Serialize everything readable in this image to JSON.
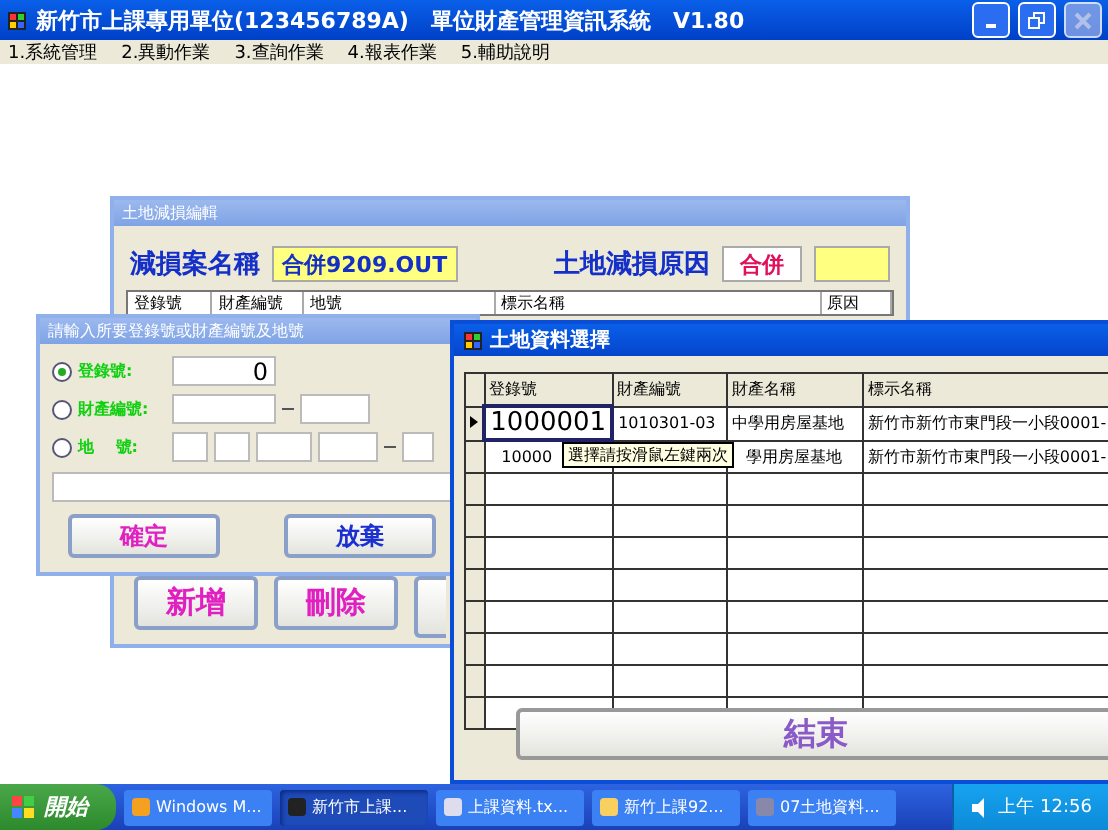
{
  "app_window": {
    "title": "新竹市上課專用單位(123456789A)　單位財產管理資訊系統　V1.80",
    "menu": [
      "1.系統管理",
      "2.異動作業",
      "3.查詢作業",
      "4.報表作業",
      "5.輔助說明"
    ]
  },
  "edit_window": {
    "title": "土地減損編輯",
    "case_label": "減損案名稱",
    "case_value": "合併9209.OUT",
    "reason_label": "土地減損原因",
    "reason_value": "合併",
    "columns": [
      "登錄號",
      "財產編號",
      "地號",
      "標示名稱",
      "原因"
    ],
    "buttons": [
      "新增",
      "刪除"
    ]
  },
  "input_dialog": {
    "title": "請輸入所要登錄號或財產編號及地號",
    "options": [
      {
        "label": "登錄號:",
        "kind": "single",
        "selected": true,
        "value": "0"
      },
      {
        "label": "財產編號:",
        "kind": "pair",
        "selected": false
      },
      {
        "label": "地　 號:",
        "kind": "land",
        "selected": false
      }
    ],
    "buttons": [
      {
        "label": "確定",
        "kind": "confirm"
      },
      {
        "label": "放棄",
        "kind": "cancel"
      }
    ]
  },
  "select_window": {
    "title": "土地資料選擇",
    "columns": [
      "登錄號",
      "財產編號",
      "財產名稱",
      "標示名稱"
    ],
    "rows": [
      {
        "selected": true,
        "cells": [
          "1000001",
          "1010301-03",
          "中學用房屋基地",
          "新竹市新竹市東門段一小段0001-"
        ]
      },
      {
        "selected": false,
        "cells": [
          "10000",
          "",
          "學用房屋基地",
          "新竹市新竹市東門段一小段0001-"
        ]
      }
    ],
    "tooltip": "選擇請按滑鼠左鍵兩次",
    "button": "結束"
  },
  "taskbar": {
    "start": "開始",
    "tasks": [
      {
        "label": "Windows M...",
        "selected": false
      },
      {
        "label": "新竹市上課...",
        "selected": true
      },
      {
        "label": "上課資料.tx...",
        "selected": false
      },
      {
        "label": "新竹上課92...",
        "selected": false
      },
      {
        "label": "07土地資料...",
        "selected": false
      }
    ],
    "clock": "上午 12:56"
  }
}
